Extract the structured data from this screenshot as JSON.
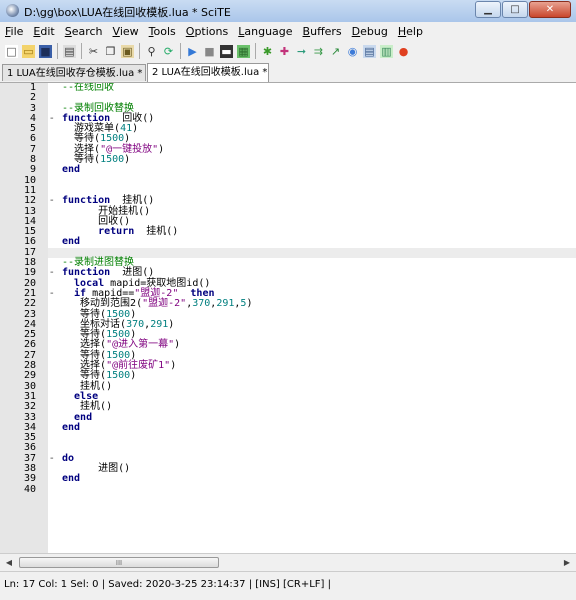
{
  "window": {
    "title": "D:\\gg\\box\\LUA在线回收模板.lua * SciTE",
    "controls": [
      "minimize-icon",
      "maximize-icon",
      "close-icon"
    ]
  },
  "menu": [
    {
      "key": "F",
      "rest": "ile"
    },
    {
      "key": "E",
      "rest": "dit"
    },
    {
      "key": "S",
      "rest": "earch"
    },
    {
      "key": "V",
      "rest": "iew"
    },
    {
      "key": "T",
      "rest": "ools"
    },
    {
      "key": "O",
      "rest": "ptions"
    },
    {
      "key": "L",
      "rest": "anguage"
    },
    {
      "key": "B",
      "rest": "uffers"
    },
    {
      "key": "D",
      "rest": "ebug"
    },
    {
      "key": "H",
      "rest": "elp"
    }
  ],
  "toolbar": {
    "icons": [
      "new-icon",
      "open-icon",
      "save-icon",
      "|",
      "print-icon",
      "|",
      "cut-icon",
      "copy-icon",
      "paste-icon",
      "|",
      "find-icon",
      "replace-icon",
      "|",
      "run-icon",
      "stop-icon",
      "console-icon",
      "script-icon",
      "|",
      "bug-icon",
      "debug-icon",
      "step-icon",
      "stepover-icon",
      "stepout-icon",
      "watch-icon",
      "tool1-icon",
      "tool2-icon",
      "record-icon"
    ]
  },
  "tabs": [
    {
      "label": "1 LUA在线回收存仓模板.lua *"
    },
    {
      "label": "2 LUA在线回收模板.lua *"
    }
  ],
  "editor": {
    "current_line": 17,
    "lines": [
      {
        "n": "1",
        "fold": "",
        "t": [
          [
            "cm",
            "--在线回收"
          ]
        ]
      },
      {
        "n": "2",
        "fold": "",
        "t": []
      },
      {
        "n": "3",
        "fold": "",
        "t": [
          [
            "cm",
            "--录制回收替换"
          ]
        ]
      },
      {
        "n": "4",
        "fold": "-",
        "t": [
          [
            "kw",
            "function"
          ],
          [
            "",
            "  回收()"
          ]
        ]
      },
      {
        "n": "5",
        "fold": "",
        "t": [
          [
            "",
            "  游戏菜单("
          ],
          [
            "num",
            "41"
          ],
          [
            "",
            ")"
          ]
        ]
      },
      {
        "n": "6",
        "fold": "",
        "t": [
          [
            "",
            "  等待("
          ],
          [
            "num",
            "1500"
          ],
          [
            "",
            ")"
          ]
        ]
      },
      {
        "n": "7",
        "fold": "",
        "t": [
          [
            "",
            "  选择("
          ],
          [
            "str",
            "\"@一键投放\""
          ],
          [
            "",
            ")"
          ]
        ]
      },
      {
        "n": "8",
        "fold": "",
        "t": [
          [
            "",
            "  等待("
          ],
          [
            "num",
            "1500"
          ],
          [
            "",
            ")"
          ]
        ]
      },
      {
        "n": "9",
        "fold": "",
        "t": [
          [
            "kw",
            "end"
          ]
        ]
      },
      {
        "n": "10",
        "fold": "",
        "t": []
      },
      {
        "n": "11",
        "fold": "",
        "t": []
      },
      {
        "n": "12",
        "fold": "-",
        "t": [
          [
            "kw",
            "function"
          ],
          [
            "",
            "  挂机()"
          ]
        ]
      },
      {
        "n": "13",
        "fold": "",
        "t": [
          [
            "",
            "      开始挂机()"
          ]
        ]
      },
      {
        "n": "14",
        "fold": "",
        "t": [
          [
            "",
            "      回收()"
          ]
        ]
      },
      {
        "n": "15",
        "fold": "",
        "t": [
          [
            "kw",
            "      return"
          ],
          [
            "",
            "  挂机()"
          ]
        ]
      },
      {
        "n": "16",
        "fold": "",
        "t": [
          [
            "kw",
            "end"
          ]
        ]
      },
      {
        "n": "17",
        "fold": "",
        "t": []
      },
      {
        "n": "18",
        "fold": "",
        "t": [
          [
            "cm",
            "--录制进图替换"
          ]
        ]
      },
      {
        "n": "19",
        "fold": "-",
        "t": [
          [
            "kw",
            "function"
          ],
          [
            "",
            "  进图()"
          ]
        ]
      },
      {
        "n": "20",
        "fold": "",
        "t": [
          [
            "kw",
            "  local"
          ],
          [
            "",
            " mapid=获取地图id()"
          ]
        ]
      },
      {
        "n": "21",
        "fold": "-",
        "t": [
          [
            "kw",
            "  if"
          ],
          [
            "",
            " mapid=="
          ],
          [
            "str",
            "\"盟迦-2\""
          ],
          [
            "kw",
            "  then"
          ]
        ]
      },
      {
        "n": "22",
        "fold": "",
        "t": [
          [
            "",
            "   移动到范围2("
          ],
          [
            "str",
            "\"盟迦-2\""
          ],
          [
            "",
            ","
          ],
          [
            "num",
            "370"
          ],
          [
            "",
            ","
          ],
          [
            "num",
            "291"
          ],
          [
            "",
            ","
          ],
          [
            "num",
            "5"
          ],
          [
            "",
            ")"
          ]
        ]
      },
      {
        "n": "23",
        "fold": "",
        "t": [
          [
            "",
            "   等待("
          ],
          [
            "num",
            "1500"
          ],
          [
            "",
            ")"
          ]
        ]
      },
      {
        "n": "24",
        "fold": "",
        "t": [
          [
            "",
            "   坐标对话("
          ],
          [
            "num",
            "370"
          ],
          [
            "",
            ","
          ],
          [
            "num",
            "291"
          ],
          [
            "",
            ")"
          ]
        ]
      },
      {
        "n": "25",
        "fold": "",
        "t": [
          [
            "",
            "   等待("
          ],
          [
            "num",
            "1500"
          ],
          [
            "",
            ")"
          ]
        ]
      },
      {
        "n": "26",
        "fold": "",
        "t": [
          [
            "",
            "   选择("
          ],
          [
            "str",
            "\"@进入第一幕\""
          ],
          [
            "",
            ")"
          ]
        ]
      },
      {
        "n": "27",
        "fold": "",
        "t": [
          [
            "",
            "   等待("
          ],
          [
            "num",
            "1500"
          ],
          [
            "",
            ")"
          ]
        ]
      },
      {
        "n": "28",
        "fold": "",
        "t": [
          [
            "",
            "   选择("
          ],
          [
            "str",
            "\"@前往废矿1\""
          ],
          [
            "",
            ")"
          ]
        ]
      },
      {
        "n": "29",
        "fold": "",
        "t": [
          [
            "",
            "   等待("
          ],
          [
            "num",
            "1500"
          ],
          [
            "",
            ")"
          ]
        ]
      },
      {
        "n": "30",
        "fold": "",
        "t": [
          [
            "",
            "   挂机()"
          ]
        ]
      },
      {
        "n": "31",
        "fold": "",
        "t": [
          [
            "kw",
            "  else"
          ]
        ]
      },
      {
        "n": "32",
        "fold": "",
        "t": [
          [
            "",
            "   挂机()"
          ]
        ]
      },
      {
        "n": "33",
        "fold": "",
        "t": [
          [
            "kw",
            "  end"
          ]
        ]
      },
      {
        "n": "34",
        "fold": "",
        "t": [
          [
            "kw",
            "end"
          ]
        ]
      },
      {
        "n": "35",
        "fold": "",
        "t": []
      },
      {
        "n": "36",
        "fold": "",
        "t": []
      },
      {
        "n": "37",
        "fold": "-",
        "t": [
          [
            "kw",
            "do"
          ]
        ]
      },
      {
        "n": "38",
        "fold": "",
        "t": [
          [
            "",
            "      进图()"
          ]
        ]
      },
      {
        "n": "39",
        "fold": "",
        "t": [
          [
            "kw",
            "end"
          ]
        ]
      },
      {
        "n": "40",
        "fold": "",
        "t": []
      }
    ]
  },
  "scrollbar": {
    "left_arrow": "◀",
    "right_arrow": "▶",
    "thumb_grip": "III"
  },
  "status": "Ln: 17 Col: 1 Sel: 0  |  Saved: 2020-3-25  23:14:37  |  [INS]  [CR+LF] |"
}
